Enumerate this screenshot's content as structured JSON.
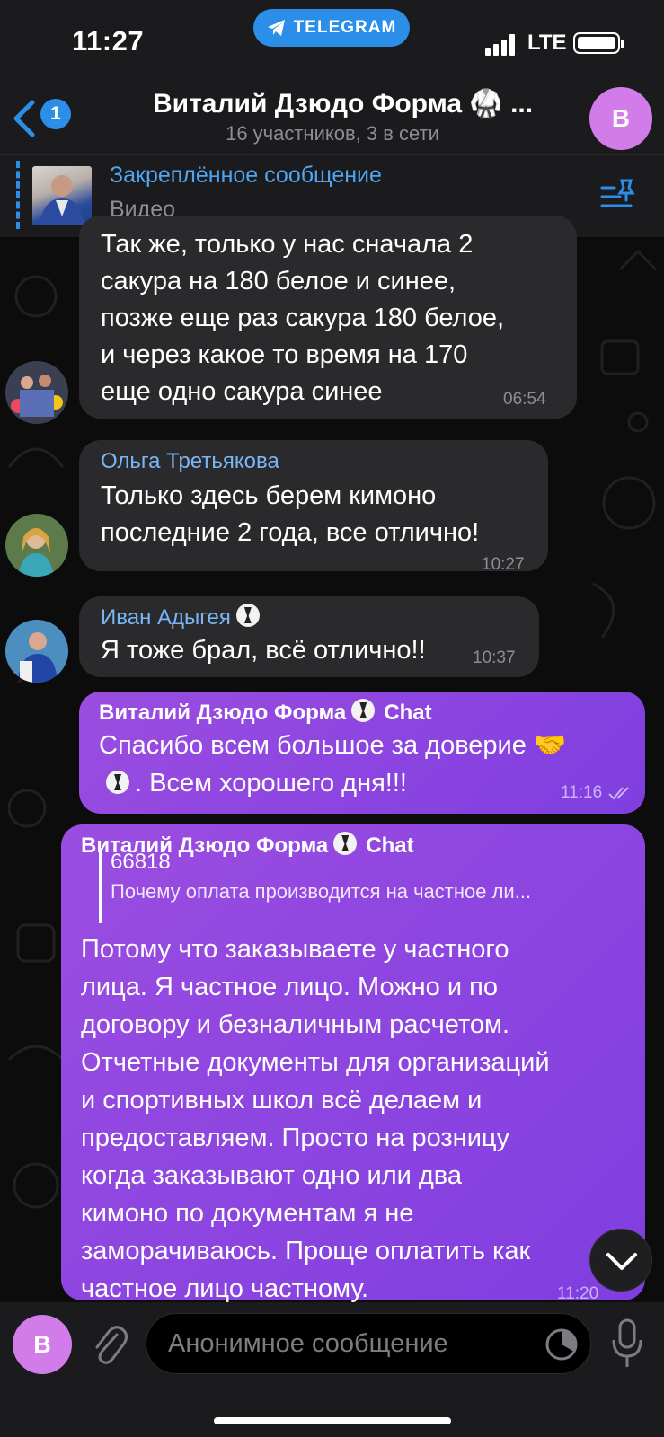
{
  "status_bar": {
    "time": "11:27",
    "app_pill": "TELEGRAM",
    "network": "LTE"
  },
  "header": {
    "back_badge": "1",
    "title": "Виталий Дзюдо Форма 🥋 ...",
    "subtitle": "16 участников, 3 в сети",
    "avatar_letter": "В"
  },
  "pinned": {
    "title": "Закреплённое сообщение",
    "subtitle": "Видео"
  },
  "messages": [
    {
      "sender": "",
      "text": "Так же, только у нас сначала 2\nсакура на 180 белое и синее,\nпозже еще раз сакура 180 белое,\nи через какое то время на 170\nеще одно сакура синее",
      "time": "06:54",
      "direction": "in"
    },
    {
      "sender": "Ольга Третьякова",
      "text": "Только здесь берем кимоно\nпоследние 2 года, все отлично!",
      "time": "10:27",
      "direction": "in"
    },
    {
      "sender": "Иван Адыгея",
      "text": "Я тоже брал, всё отлично!!",
      "time": "10:37",
      "direction": "in"
    },
    {
      "sender": "Виталий Дзюдо Форма",
      "sender_suffix": "Chat",
      "text_line1": "Спасибо всем большое за доверие 🤝",
      "text_line2": ". Всем хорошего дня!!!",
      "time": "11:16",
      "direction": "out"
    },
    {
      "sender": "Виталий Дзюдо Форма",
      "sender_suffix": "Chat",
      "reply_title": "66818",
      "reply_text": "Почему оплата производится на частное ли...",
      "text": "Потому что заказываете у частного\nлица. Я частное лицо. Можно и по\nдоговору и безналичным расчетом.\nОтчетные документы для организаций\nи спортивных школ всё делаем и\nпредоставляем. Просто на розницу\nкогда заказывают одно или два\nкимоно по документам я не\nзаморачиваюсь. Проще оплатить как\nчастное лицо частному.",
      "time": "11:20",
      "direction": "out"
    }
  ],
  "composer": {
    "avatar_letter": "В",
    "placeholder": "Анонимное сообщение"
  },
  "colors": {
    "accent": "#2b8ee9",
    "outgoing_bubble": "#8a44e0",
    "incoming_bubble": "#2a2a2c",
    "avatar": "#d17ce8"
  },
  "icons": [
    "telegram-icon",
    "signal-icon",
    "battery-icon",
    "back-chevron-icon",
    "pin-list-icon",
    "double-check-icon",
    "chevron-down-icon",
    "paperclip-icon",
    "timer-icon",
    "microphone-icon"
  ]
}
